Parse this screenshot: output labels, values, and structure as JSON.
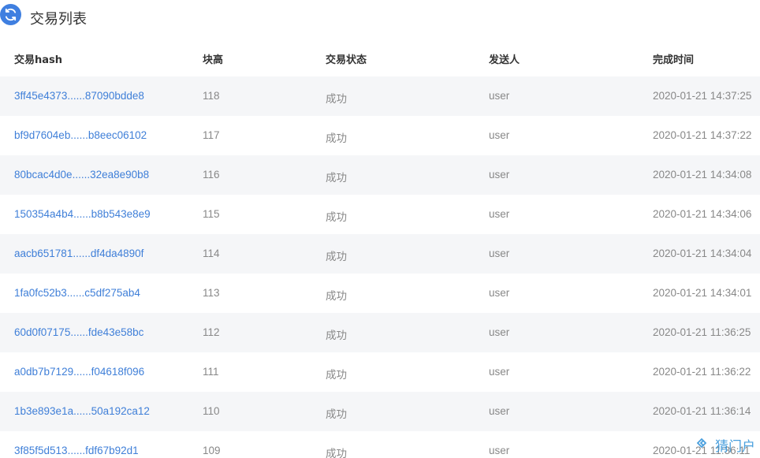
{
  "header": {
    "title": "交易列表",
    "icon": "refresh-icon",
    "accent": "#3f7fe0"
  },
  "table": {
    "columns": [
      "交易hash",
      "块高",
      "交易状态",
      "发送人",
      "完成时间"
    ],
    "rows": [
      {
        "hash": "3ff45e4373......87090bdde8",
        "height": "118",
        "status": "成功",
        "sender": "user",
        "time": "2020-01-21 14:37:25"
      },
      {
        "hash": "bf9d7604eb......b8eec06102",
        "height": "117",
        "status": "成功",
        "sender": "user",
        "time": "2020-01-21 14:37:22"
      },
      {
        "hash": "80bcac4d0e......32ea8e90b8",
        "height": "116",
        "status": "成功",
        "sender": "user",
        "time": "2020-01-21 14:34:08"
      },
      {
        "hash": "150354a4b4......b8b543e8e9",
        "height": "115",
        "status": "成功",
        "sender": "user",
        "time": "2020-01-21 14:34:06"
      },
      {
        "hash": "aacb651781......df4da4890f",
        "height": "114",
        "status": "成功",
        "sender": "user",
        "time": "2020-01-21 14:34:04"
      },
      {
        "hash": "1fa0fc52b3......c5df275ab4",
        "height": "113",
        "status": "成功",
        "sender": "user",
        "time": "2020-01-21 14:34:01"
      },
      {
        "hash": "60d0f07175......fde43e58bc",
        "height": "112",
        "status": "成功",
        "sender": "user",
        "time": "2020-01-21 11:36:25"
      },
      {
        "hash": "a0db7b7129......f04618f096",
        "height": "111",
        "status": "成功",
        "sender": "user",
        "time": "2020-01-21 11:36:22"
      },
      {
        "hash": "1b3e893e1a......50a192ca12",
        "height": "110",
        "status": "成功",
        "sender": "user",
        "time": "2020-01-21 11:36:14"
      },
      {
        "hash": "3f85f5d513......fdf67b92d1",
        "height": "109",
        "status": "成功",
        "sender": "user",
        "time": "2020-01-21 11:36:11"
      }
    ],
    "link_color": "#3f7fd8",
    "stripe_color": "#f5f6f8"
  },
  "watermark": {
    "text": "猜门户",
    "icon": "diamond-logo-icon"
  }
}
